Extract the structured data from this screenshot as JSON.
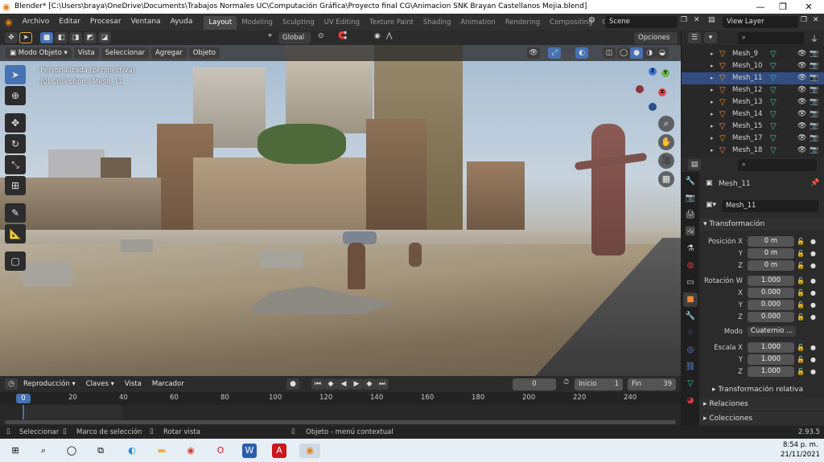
{
  "window": {
    "title": "Blender* [C:\\Users\\braya\\OneDrive\\Documents\\Trabajos Normales UC\\Computación Gráfica\\Proyecto final CG\\Animacion SNK Brayan Castellanos Mejia.blend]",
    "minimize": "—",
    "maximize": "❐",
    "close": "✕"
  },
  "menu": [
    "Archivo",
    "Editar",
    "Procesar",
    "Ventana",
    "Ayuda"
  ],
  "workspaces": [
    "Layout",
    "Modeling",
    "Sculpting",
    "UV Editing",
    "Texture Paint",
    "Shading",
    "Animation",
    "Rendering",
    "Compositing",
    "Geon"
  ],
  "active_workspace": "Layout",
  "scene": "Scene",
  "view_layer": "View Layer",
  "viewport_header": {
    "transform_orientation": "Global",
    "options": "Opciones",
    "mode": "Modo Objeto",
    "menus": [
      "Vista",
      "Seleccionar",
      "Agregar",
      "Objeto"
    ]
  },
  "viewport_overlay": {
    "view_name": "Personalizada (perspectiva)",
    "collection_info": "(0) Collection | Mesh_11"
  },
  "gizmo": {
    "x": "X",
    "y": "Y",
    "z": "Z"
  },
  "timeline": {
    "playback": "Reproducción",
    "keying": "Claves",
    "view": "Vista",
    "marker": "Marcador",
    "current_frame": "0",
    "start_label": "Inicio",
    "start": "1",
    "end_label": "Fin",
    "end": "39",
    "ruler_current": "0",
    "ticks": [
      "20",
      "40",
      "60",
      "80",
      "100",
      "120",
      "140",
      "160",
      "180",
      "200",
      "220",
      "240"
    ]
  },
  "statusbar": {
    "select": "Seleccionar",
    "box_select": "Marco de selección",
    "rotate": "Rotar vista",
    "context": "Objeto - menú contextual",
    "version": "2.93.5"
  },
  "outliner": {
    "rows": [
      {
        "name": "Mesh_9",
        "selected": false
      },
      {
        "name": "Mesh_10",
        "selected": false
      },
      {
        "name": "Mesh_11",
        "selected": true
      },
      {
        "name": "Mesh_12",
        "selected": false
      },
      {
        "name": "Mesh_13",
        "selected": false
      },
      {
        "name": "Mesh_14",
        "selected": false
      },
      {
        "name": "Mesh_15",
        "selected": false
      },
      {
        "name": "Mesh_17",
        "selected": false
      },
      {
        "name": "Mesh_18",
        "selected": false
      }
    ]
  },
  "properties": {
    "object_name": "Mesh_11",
    "data_name": "Mesh_11",
    "transform_title": "Transformación",
    "location_label": "Posición X",
    "location": [
      "0 m",
      "0 m",
      "0 m"
    ],
    "rotation_label": "Rotación W",
    "rotation": [
      "1.000",
      "0.000",
      "0.000",
      "0.000"
    ],
    "mode_label": "Modo",
    "mode_value": "Cuaternio ...",
    "scale_label": "Escala X",
    "scale": [
      "1.000",
      "1.000",
      "1.000"
    ],
    "axis_y": "Y",
    "axis_z": "Z",
    "axis_x": "X",
    "relative_transform": "Transformación relativa",
    "relations": "Relaciones",
    "collections": "Colecciones"
  },
  "taskbar": {
    "time": "8:54 p. m.",
    "date": "21/11/2021"
  },
  "colors": {
    "accent": "#4772b3",
    "selected_row": "#334d80",
    "object_orange": "#f08b2c",
    "mesh_green": "#3ec4a0"
  }
}
